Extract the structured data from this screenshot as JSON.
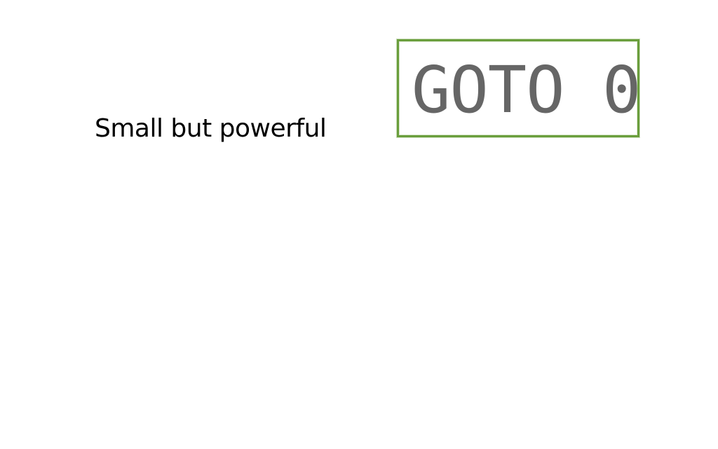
{
  "slide": {
    "tagline": "Small but powerful",
    "logo_text": "GOTO 0"
  },
  "colors": {
    "background": "#ffffff",
    "tagline_text": "#000000",
    "logo_text": "#666666",
    "logo_border": "#6a9e3c"
  }
}
